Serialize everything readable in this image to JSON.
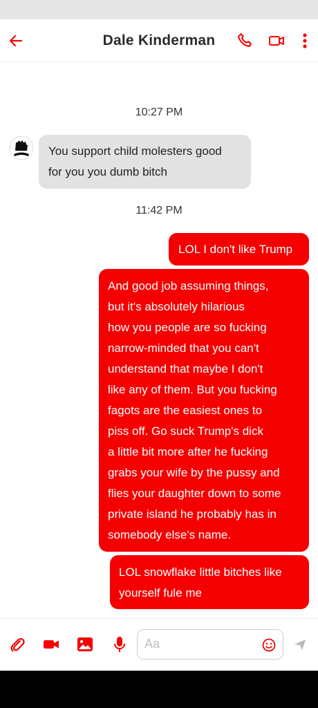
{
  "header": {
    "contact_name": "Dale Kinderman",
    "back_icon": "arrow-left-icon",
    "actions": [
      "phone-icon",
      "video-camera-icon",
      "more-vertical-icon"
    ],
    "accent_color": "#f50000"
  },
  "thread": {
    "timestamps": [
      "10:27 PM",
      "11:42 PM"
    ],
    "messages": [
      {
        "direction": "incoming",
        "lines": [
          "You support child molesters good",
          "for you you dumb bitch"
        ]
      },
      {
        "direction": "outgoing",
        "lines": [
          "LOL I don't like Trump"
        ]
      },
      {
        "direction": "outgoing",
        "lines": [
          "And good job assuming things,",
          "but it's absolutely hilarious",
          "how you people are so fucking",
          "narrow-minded that you can't",
          "understand that maybe I don't",
          "like any of them. But you fucking",
          "fagots are the easiest ones to",
          "piss off. Go suck Trump's dick",
          "a little bit more after he fucking",
          "grabs your wife by the pussy and",
          "flies your daughter down to some",
          "private island he probably has in",
          "somebody else's name."
        ]
      },
      {
        "direction": "outgoing",
        "lines": [
          "LOL snowflake little bitches like",
          "yourself fule me"
        ]
      }
    ]
  },
  "composer": {
    "placeholder": "Aa",
    "icons": [
      "paperclip-icon",
      "video-camera-icon",
      "image-icon",
      "microphone-icon",
      "emoji-icon",
      "send-icon"
    ]
  }
}
